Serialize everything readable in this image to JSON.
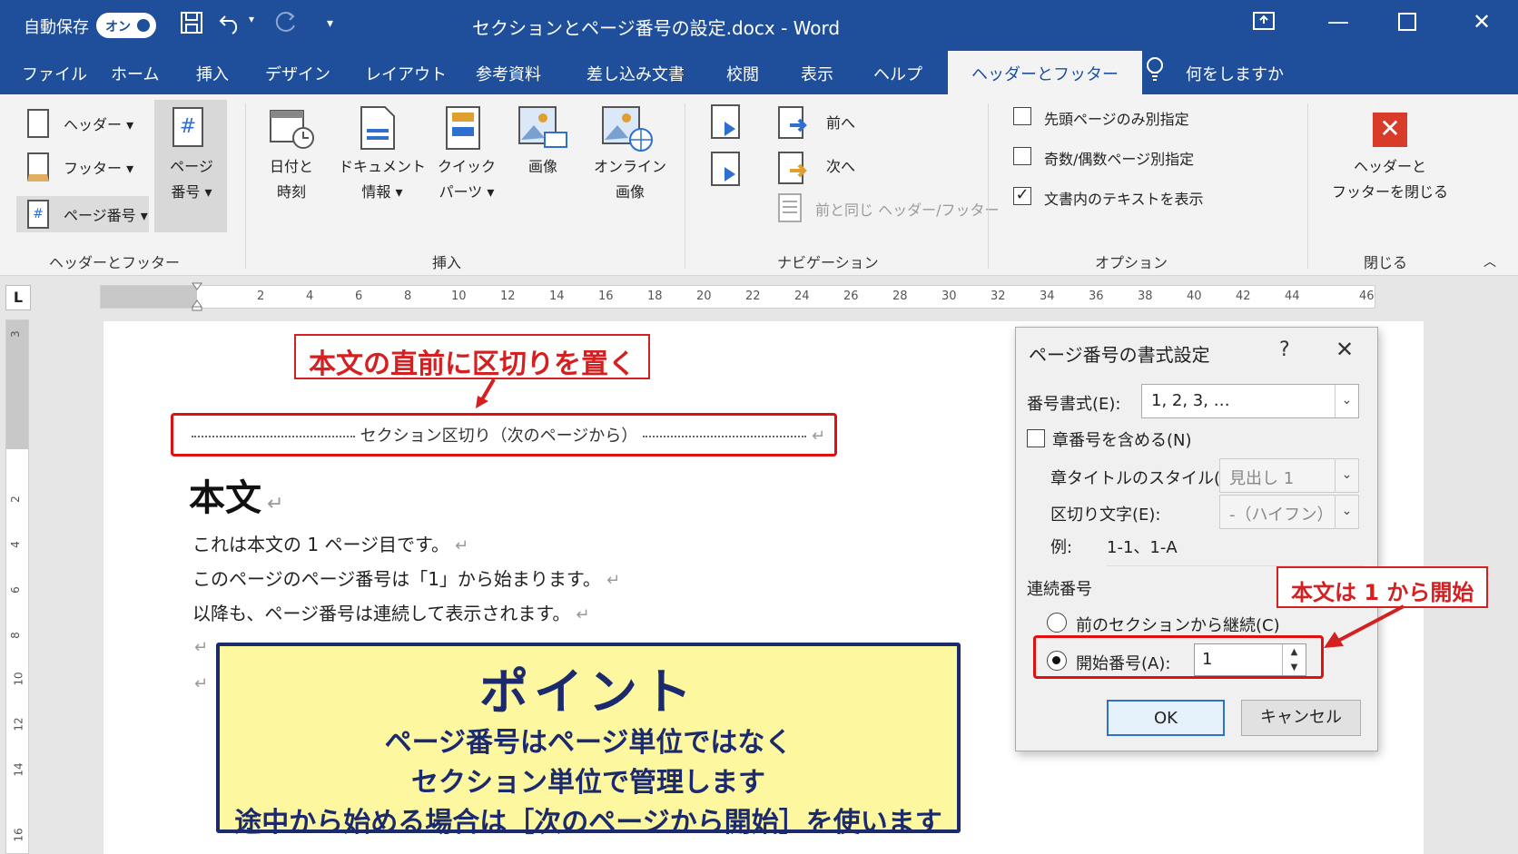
{
  "titlebar": {
    "autosave_label": "自動保存",
    "autosave_toggle": "オン",
    "doc_title": "セクションとページ番号の設定.docx  -  Word"
  },
  "tabs": [
    "ファイル",
    "ホーム",
    "挿入",
    "デザイン",
    "レイアウト",
    "参考資料",
    "差し込み文書",
    "校閲",
    "表示",
    "ヘルプ",
    "ヘッダーとフッター",
    "何をしますか"
  ],
  "ribbon": {
    "header_footer_group": {
      "header": "ヘッダー",
      "footer": "フッター",
      "page_number": "ページ番号",
      "page_number_big_1": "ページ",
      "page_number_big_2": "番号",
      "label": "ヘッダーとフッター"
    },
    "insert_group": {
      "datetime_1": "日付と",
      "datetime_2": "時刻",
      "docinfo_1": "ドキュメント",
      "docinfo_2": "情報",
      "quickparts_1": "クイック",
      "quickparts_2": "パーツ",
      "picture": "画像",
      "online_1": "オンライン",
      "online_2": "画像",
      "label": "挿入"
    },
    "nav_group": {
      "prev": "前へ",
      "next": "次へ",
      "link_prev": "前と同じ ヘッダー/フッター",
      "label": "ナビゲーション"
    },
    "options_group": {
      "first_page": "先頭ページのみ別指定",
      "odd_even": "奇数/偶数ページ別指定",
      "show_text": "文書内のテキストを表示",
      "label": "オプション"
    },
    "close_group": {
      "close_1": "ヘッダーと",
      "close_2": "フッターを閉じる",
      "label": "閉じる"
    }
  },
  "ruler": {
    "tab_selector": "L",
    "numbers": [
      "2",
      "4",
      "6",
      "8",
      "10",
      "12",
      "14",
      "16",
      "18",
      "20",
      "22",
      "24",
      "26",
      "28",
      "30",
      "32",
      "34",
      "36",
      "38",
      "40",
      "42",
      "44",
      "46"
    ],
    "vnumbers": [
      "3",
      "2",
      "4",
      "6",
      "8",
      "10",
      "12",
      "14",
      "16"
    ]
  },
  "document": {
    "callout_top": "本文の直前に区切りを置く",
    "section_break": "セクション区切り（次のページから）",
    "heading": "本文",
    "lines": [
      "これは本文の 1 ページ目です。",
      "このページのページ番号は「1」から始まります。",
      "以降も、ページ番号は連続して表示されます。"
    ],
    "para_mark": "↵",
    "point_title": "ポイント",
    "point_lines": [
      "ページ番号はページ単位ではなく",
      "セクション単位で管理します",
      "途中から始める場合は［次のページから開始］を使います"
    ]
  },
  "dialog": {
    "title": "ページ番号の書式設定",
    "help": "?",
    "close": "✕",
    "format_label": "番号書式(E):",
    "format_value": "1, 2, 3, …",
    "include_chapter": "章番号を含める(N)",
    "chapter_style_label": "章タイトルのスタイル(P):",
    "chapter_style_value": "見出し 1",
    "separator_label": "区切り文字(E):",
    "separator_value": "-（ハイフン）",
    "example_label": "例:",
    "example_value": "1-1、1-A",
    "numbering_label": "連続番号",
    "continue_label": "前のセクションから継続(C)",
    "start_label": "開始番号(A):",
    "start_value": "1",
    "ok": "OK",
    "cancel": "キャンセル",
    "callout": "本文は 1 から開始"
  },
  "colors": {
    "word_blue": "#1f4e9b",
    "callout_red": "#d42020",
    "point_bg": "#fdf7a0",
    "point_fg": "#1a2a6c"
  }
}
